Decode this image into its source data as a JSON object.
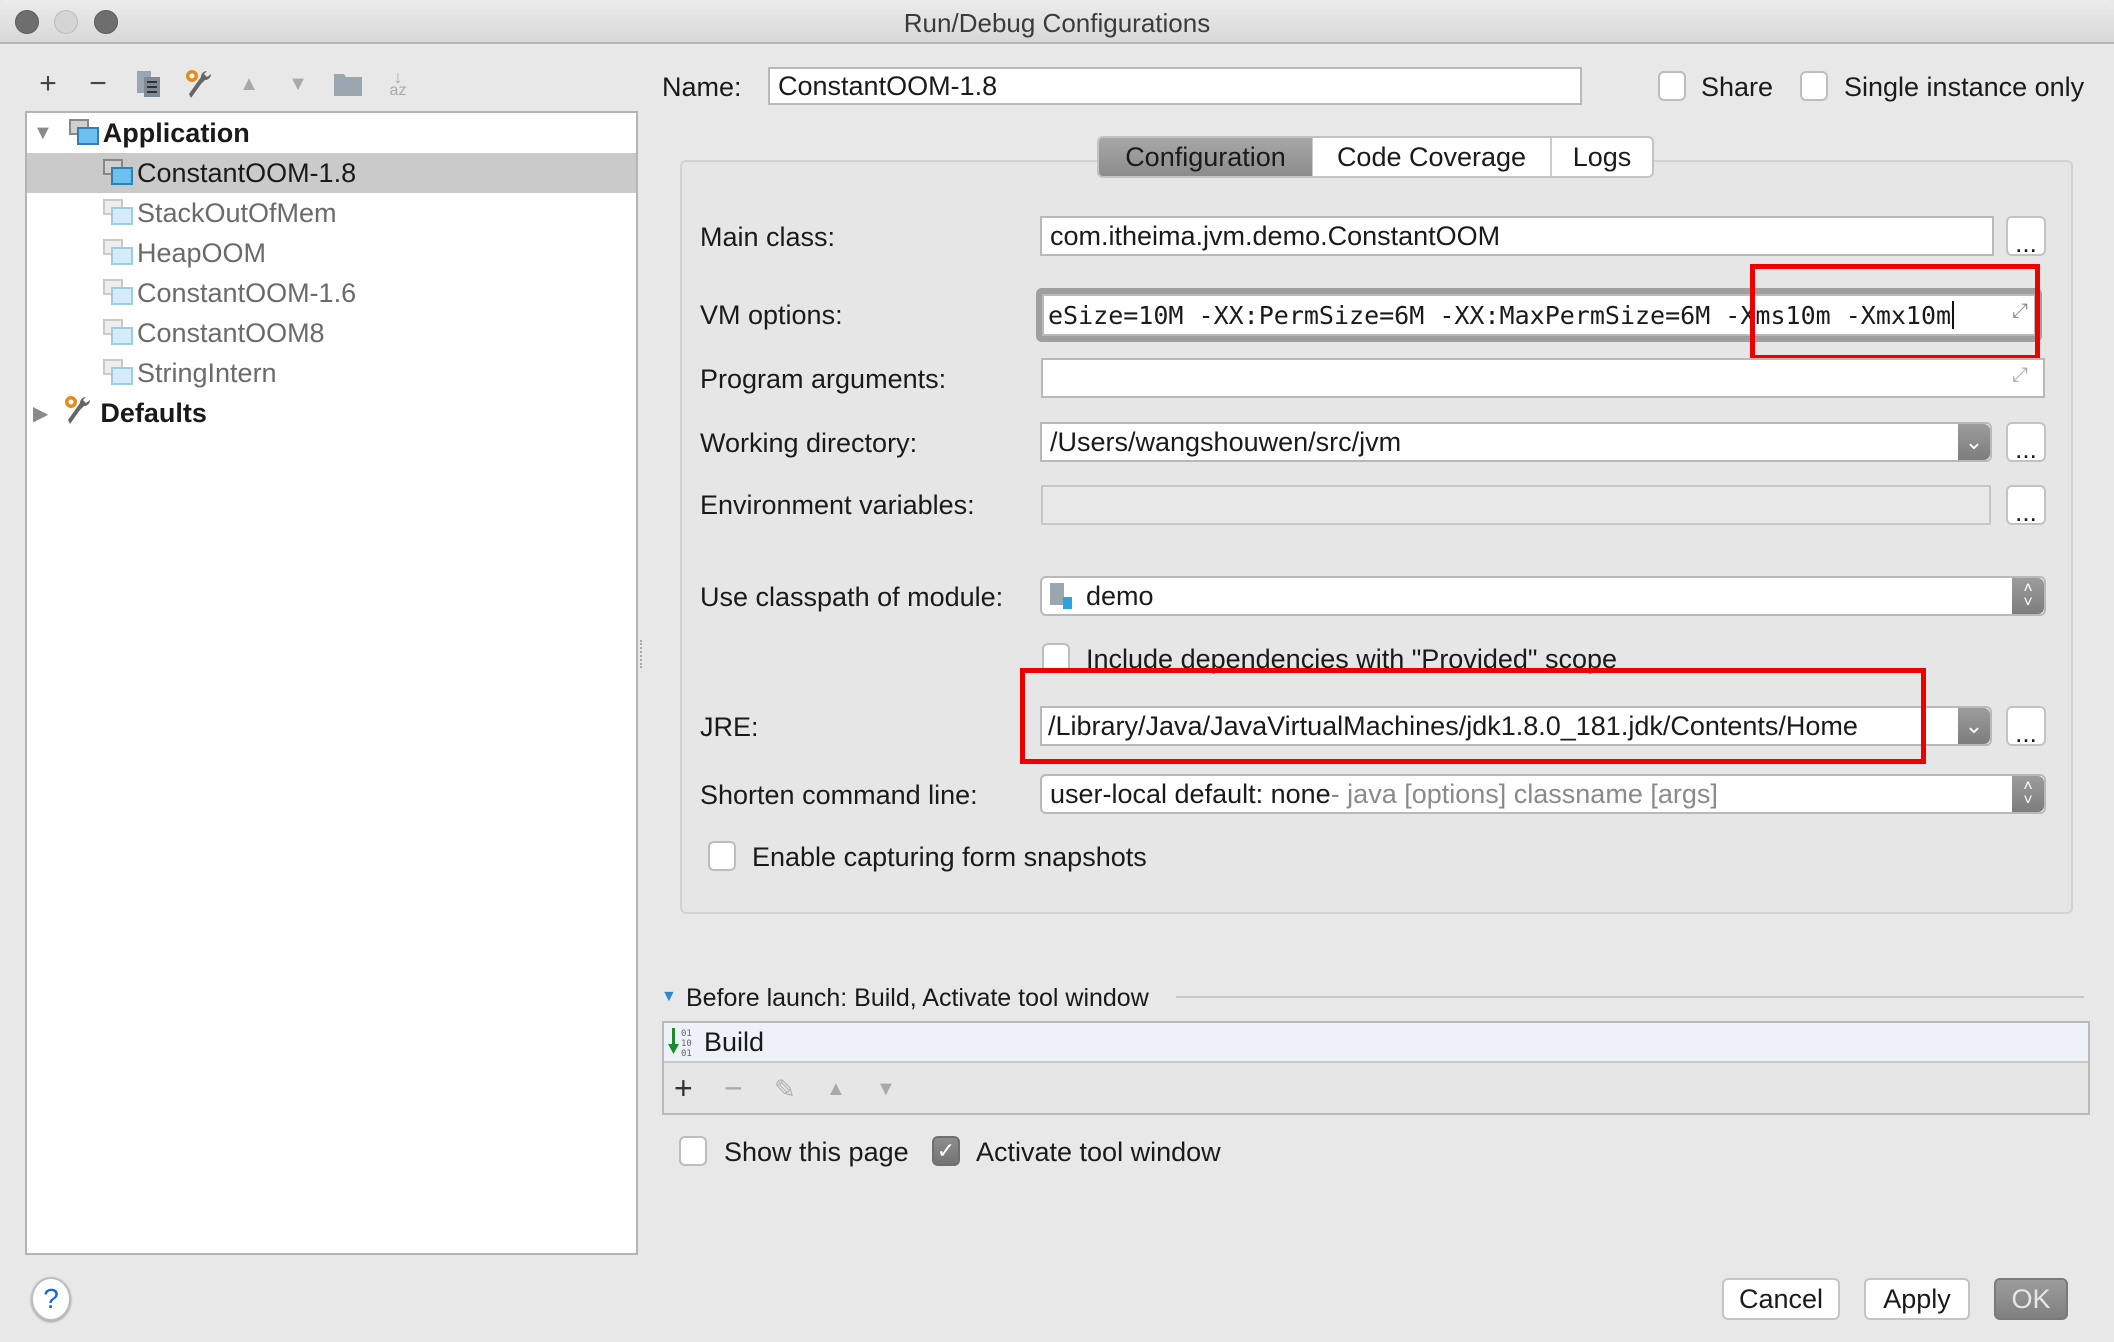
{
  "window": {
    "title": "Run/Debug Configurations"
  },
  "toolbar": {
    "icons": [
      "add-icon",
      "remove-icon",
      "copy-icon",
      "edit-defaults-icon",
      "move-up-icon",
      "move-down-icon",
      "folder-icon",
      "sort-icon"
    ]
  },
  "tree": {
    "groups": [
      {
        "label": "Application",
        "expanded": true
      },
      {
        "label": "Defaults",
        "expanded": false
      }
    ],
    "items": [
      {
        "label": "ConstantOOM-1.8",
        "selected": true
      },
      {
        "label": "StackOutOfMem",
        "selected": false
      },
      {
        "label": "HeapOOM",
        "selected": false
      },
      {
        "label": "ConstantOOM-1.6",
        "selected": false
      },
      {
        "label": "ConstantOOM8",
        "selected": false
      },
      {
        "label": "StringIntern",
        "selected": false
      }
    ]
  },
  "header": {
    "name_label": "Name:",
    "name_value": "ConstantOOM-1.8",
    "share_label": "Share",
    "share_checked": false,
    "single_instance_label": "Single instance only",
    "single_instance_checked": false
  },
  "tabs": [
    {
      "label": "Configuration",
      "active": true
    },
    {
      "label": "Code Coverage",
      "active": false
    },
    {
      "label": "Logs",
      "active": false
    }
  ],
  "form": {
    "main_class_label": "Main class:",
    "main_class_value": "com.itheima.jvm.demo.ConstantOOM",
    "vm_options_label": "VM options:",
    "vm_options_value": "eSize=10M -XX:PermSize=6M -XX:MaxPermSize=6M -Xms10m -Xmx10m",
    "program_args_label": "Program arguments:",
    "program_args_value": "",
    "working_dir_label": "Working directory:",
    "working_dir_value": "/Users/wangshouwen/src/jvm",
    "env_vars_label": "Environment variables:",
    "env_vars_value": "",
    "classpath_label": "Use classpath of module:",
    "classpath_value": "demo",
    "include_deps_label": "Include dependencies with \"Provided\" scope",
    "include_deps_checked": false,
    "jre_label": "JRE:",
    "jre_value": "/Library/Java/JavaVirtualMachines/jdk1.8.0_181.jdk/Contents/Home",
    "shorten_label": "Shorten command line:",
    "shorten_value": "user-local default: none",
    "shorten_hint": " - java [options] classname [args]",
    "snapshots_label": "Enable capturing form snapshots",
    "snapshots_checked": false,
    "browse_label": "..."
  },
  "before_launch": {
    "title": "Before launch: Build, Activate tool window",
    "tasks": [
      {
        "label": "Build"
      }
    ],
    "show_page_label": "Show this page",
    "show_page_checked": false,
    "activate_label": "Activate tool window",
    "activate_checked": true
  },
  "footer": {
    "help_label": "?",
    "cancel_label": "Cancel",
    "apply_label": "Apply",
    "ok_label": "OK"
  },
  "annotations": {
    "highlight_color": "#ee0000"
  }
}
